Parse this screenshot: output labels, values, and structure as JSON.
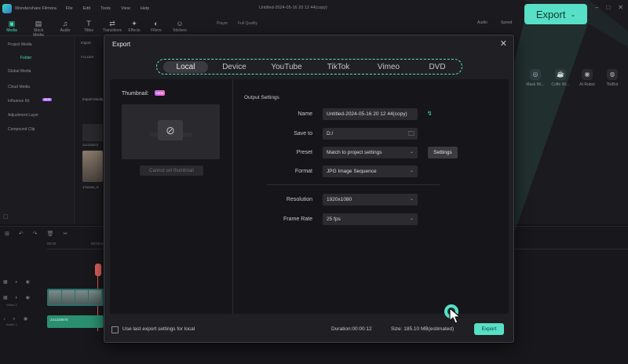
{
  "app": {
    "name": "Wondershare Filmora",
    "menu": [
      "File",
      "Edit",
      "Tools",
      "View",
      "Help"
    ],
    "document_title": "Untitled-2024-05-16 20 12 44(copy)"
  },
  "toolbar": {
    "items": [
      {
        "label": "Media",
        "icon": "media-icon"
      },
      {
        "label": "Stock Media",
        "icon": "stock-media-icon"
      },
      {
        "label": "Audio",
        "icon": "audio-icon"
      },
      {
        "label": "Titles",
        "icon": "titles-icon"
      },
      {
        "label": "Transitions",
        "icon": "transitions-icon"
      },
      {
        "label": "Effects",
        "icon": "effects-icon"
      },
      {
        "label": "Filters",
        "icon": "filters-icon"
      },
      {
        "label": "Stickers",
        "icon": "stickers-icon"
      }
    ],
    "player_label": "Player",
    "quality_label": "Full Quality"
  },
  "sidebar": {
    "items": [
      "Project Media",
      "Folder",
      "Global Media",
      "Cloud Media",
      "Influence Kit",
      "Adjustment Layer",
      "Compound Clip"
    ],
    "influence_badge": "NEW"
  },
  "media_pane": {
    "import_label": "Import",
    "folder_label": "FOLDER",
    "import_media_label": "Import Media",
    "clip1_label": "241220870",
    "clip2_label": "4750164_G"
  },
  "right_panel": {
    "tabs": [
      "Audio",
      "Speed"
    ],
    "icons": [
      "Mask Wi...",
      "Coffe Wi...",
      "AI Robot",
      "TikiBot"
    ]
  },
  "timeline": {
    "ruler": [
      "00:00",
      "00:00:05:00",
      "00:00:10:00"
    ],
    "video_track": "Video 1",
    "audio_track": "Audio 1",
    "audio_clip": "241220870"
  },
  "callout": {
    "label": "Export",
    "chevron": "⌄"
  },
  "dialog": {
    "title": "Export",
    "close": "✕",
    "tabs": [
      "Local",
      "Device",
      "YouTube",
      "TikTok",
      "Vimeo",
      "DVD"
    ],
    "active_tab": "Local",
    "thumbnail_label": "Thumbnail:",
    "new_badge": "NEW",
    "thumbnail_glyph": "⊘",
    "cannot_set_thumbnail": "Cannot set thumbnail",
    "output_settings_title": "Output Settings",
    "fields": {
      "name": {
        "label": "Name",
        "value": "Untitled-2024-05-16 20 12 44(copy)"
      },
      "save_to": {
        "label": "Save to",
        "value": "D:/"
      },
      "preset": {
        "label": "Preset",
        "value": "Match to project settings"
      },
      "format": {
        "label": "Format",
        "value": "JPG Image Sequence"
      },
      "resolution": {
        "label": "Resolution",
        "value": "1920x1080"
      },
      "frame_rate": {
        "label": "Frame Rate",
        "value": "25 fps"
      }
    },
    "settings_button": "Settings",
    "use_last_settings": "Use last export settings for local",
    "duration": "Duration:00:00:12",
    "size": "Size: 185.10 MB(estimated)",
    "export_button": "Export"
  },
  "colors": {
    "accent": "#57e0c6",
    "dialog_bg": "#202024",
    "body_bg": "#16161a"
  }
}
